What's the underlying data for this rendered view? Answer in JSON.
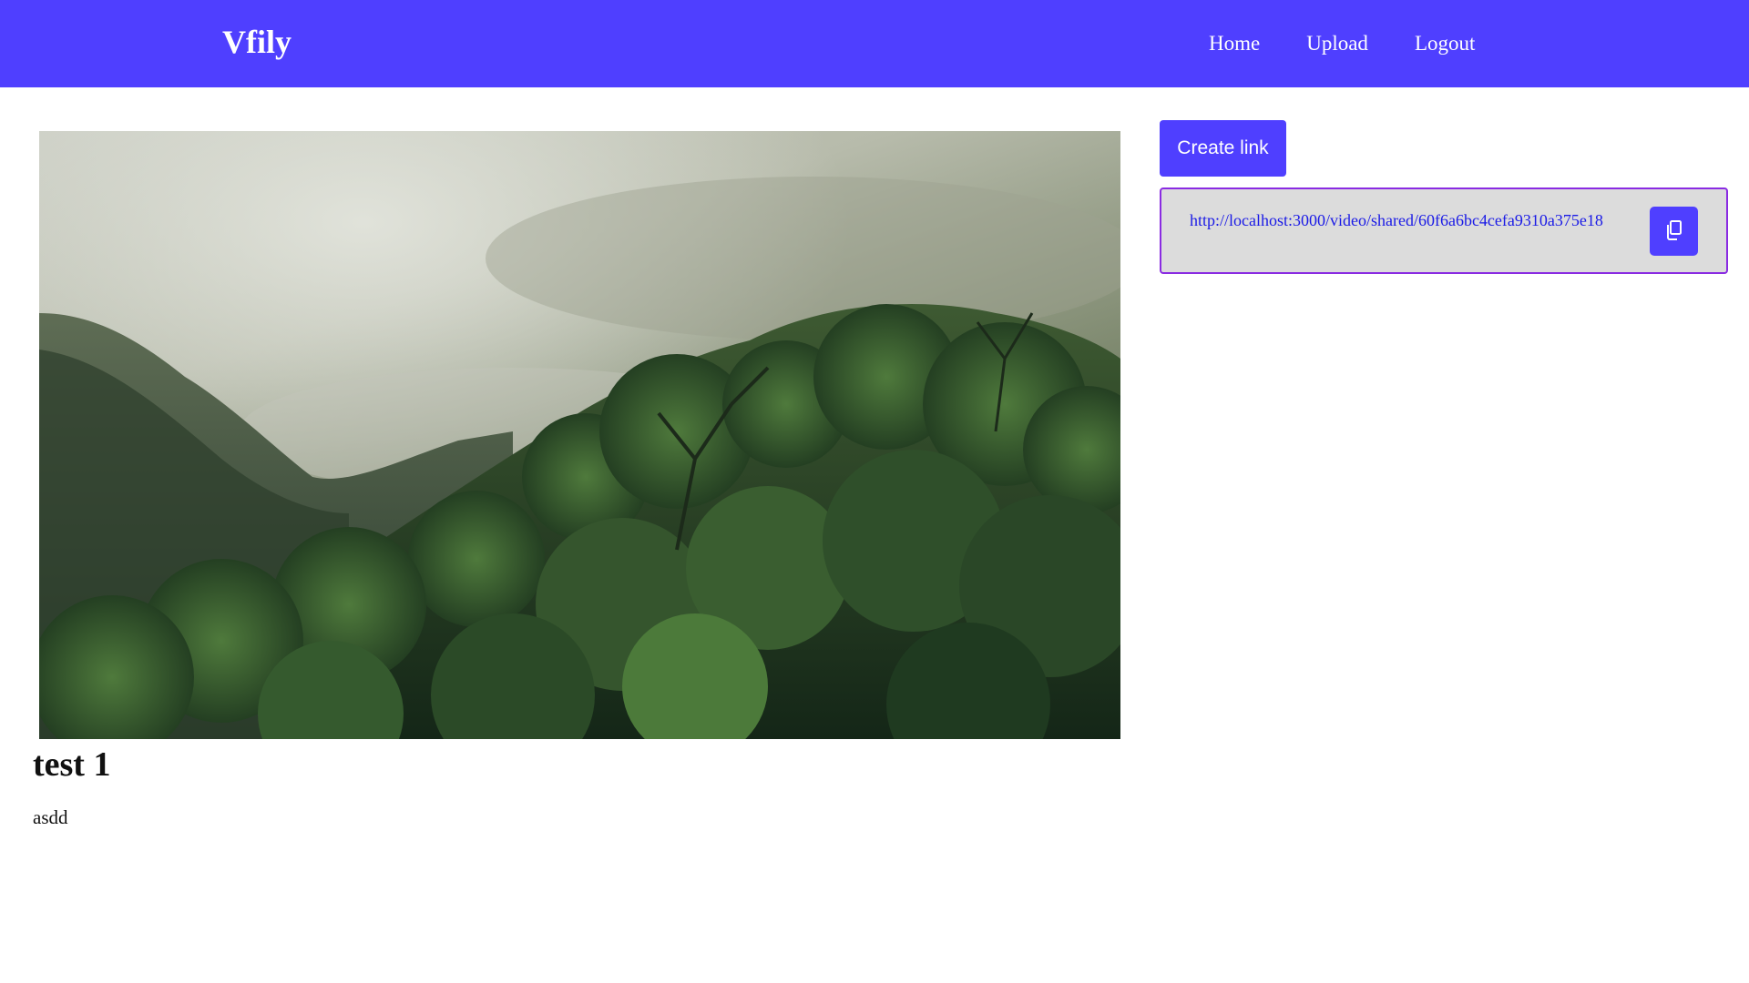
{
  "navbar": {
    "brand": "Vfily",
    "links": [
      "Home",
      "Upload",
      "Logout"
    ],
    "color": "#4f3fff"
  },
  "video": {
    "title": "test 1",
    "description": "asdd"
  },
  "share": {
    "create_link_label": "Create link",
    "link_url": "http://localhost:3000/video/shared/60f6a6bc4cefa9310a375e18",
    "copy_icon": "copy-icon"
  }
}
